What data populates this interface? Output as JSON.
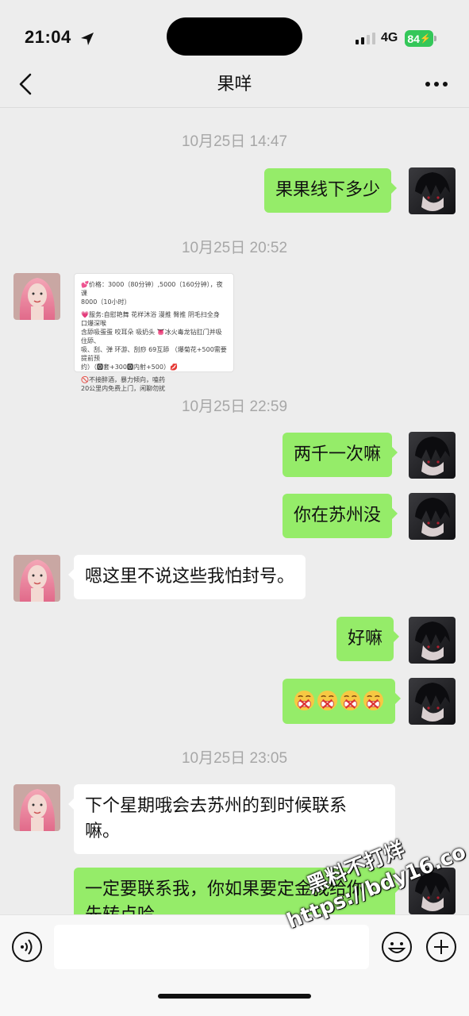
{
  "status_bar": {
    "time": "21:04",
    "network": "4G",
    "battery": "84"
  },
  "header": {
    "title": "果咩"
  },
  "messages": {
    "ts1": "10月25日 14:47",
    "m1": "果果线下多少",
    "ts2": "10月25日 20:52",
    "image_lines": [
      "💕价格：3000（80分钟）,5000（160分钟），夜课",
      "8000（10小时）",
      "",
      "💗服务:自慰艳舞 花样沐浴 漫推 臀推 阴毛扫全身 口爆深喉",
      "含舔吸蛋蛋 咬耳朵 吸奶头 👅冰火毒龙钻肛门并吸住舔、",
      "吸、刮、弹 环游、刮痧 69互舔 （爆菊花+500需要提前预",
      "约）（🅾套+300🅾内射+500）💋",
      "",
      "🚫不接醉酒，暴力倾向，嗑药",
      "20公里内免费上门，闲聊勿扰"
    ],
    "ts3": "10月25日 22:59",
    "m3": "两千一次嘛",
    "m4": "你在苏州没",
    "m5": "嗯这里不说这些我怕封号。",
    "m6": "好嘛",
    "ts4": "10月25日 23:05",
    "m8_line1": "下个星期哦会去苏州的到时候联系",
    "m8_line2": "嘛。",
    "m9_line1": "一定要联系我，你如果要定金我给你",
    "m9_line2": "先转点哈"
  },
  "input": {
    "placeholder": ""
  },
  "watermark": {
    "line1": "黑料不打烊",
    "line2": "https://bdy16.co"
  },
  "colors": {
    "outgoing_bubble": "#95ec69",
    "incoming_bubble": "#ffffff",
    "background": "#ededed",
    "battery": "#34c759"
  },
  "icons": [
    "location-arrow-icon",
    "back-chevron-icon",
    "more-dots-icon",
    "voice-icon",
    "emoji-icon",
    "plus-icon",
    "grimace-emoji-icon"
  ]
}
